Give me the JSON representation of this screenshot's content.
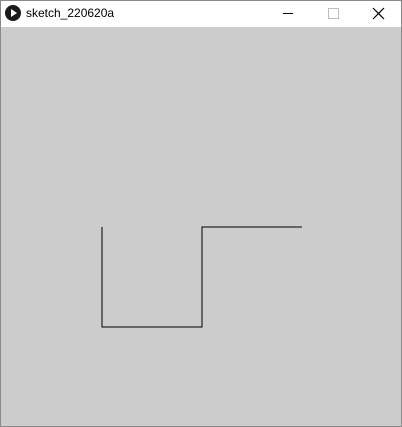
{
  "window": {
    "title": "sketch_220620a",
    "app_icon": "processing-play-icon",
    "controls": [
      "minimize-icon",
      "maximize-icon",
      "close-icon"
    ]
  },
  "canvas": {
    "background": "#cccccc",
    "stroke": "#000000"
  }
}
